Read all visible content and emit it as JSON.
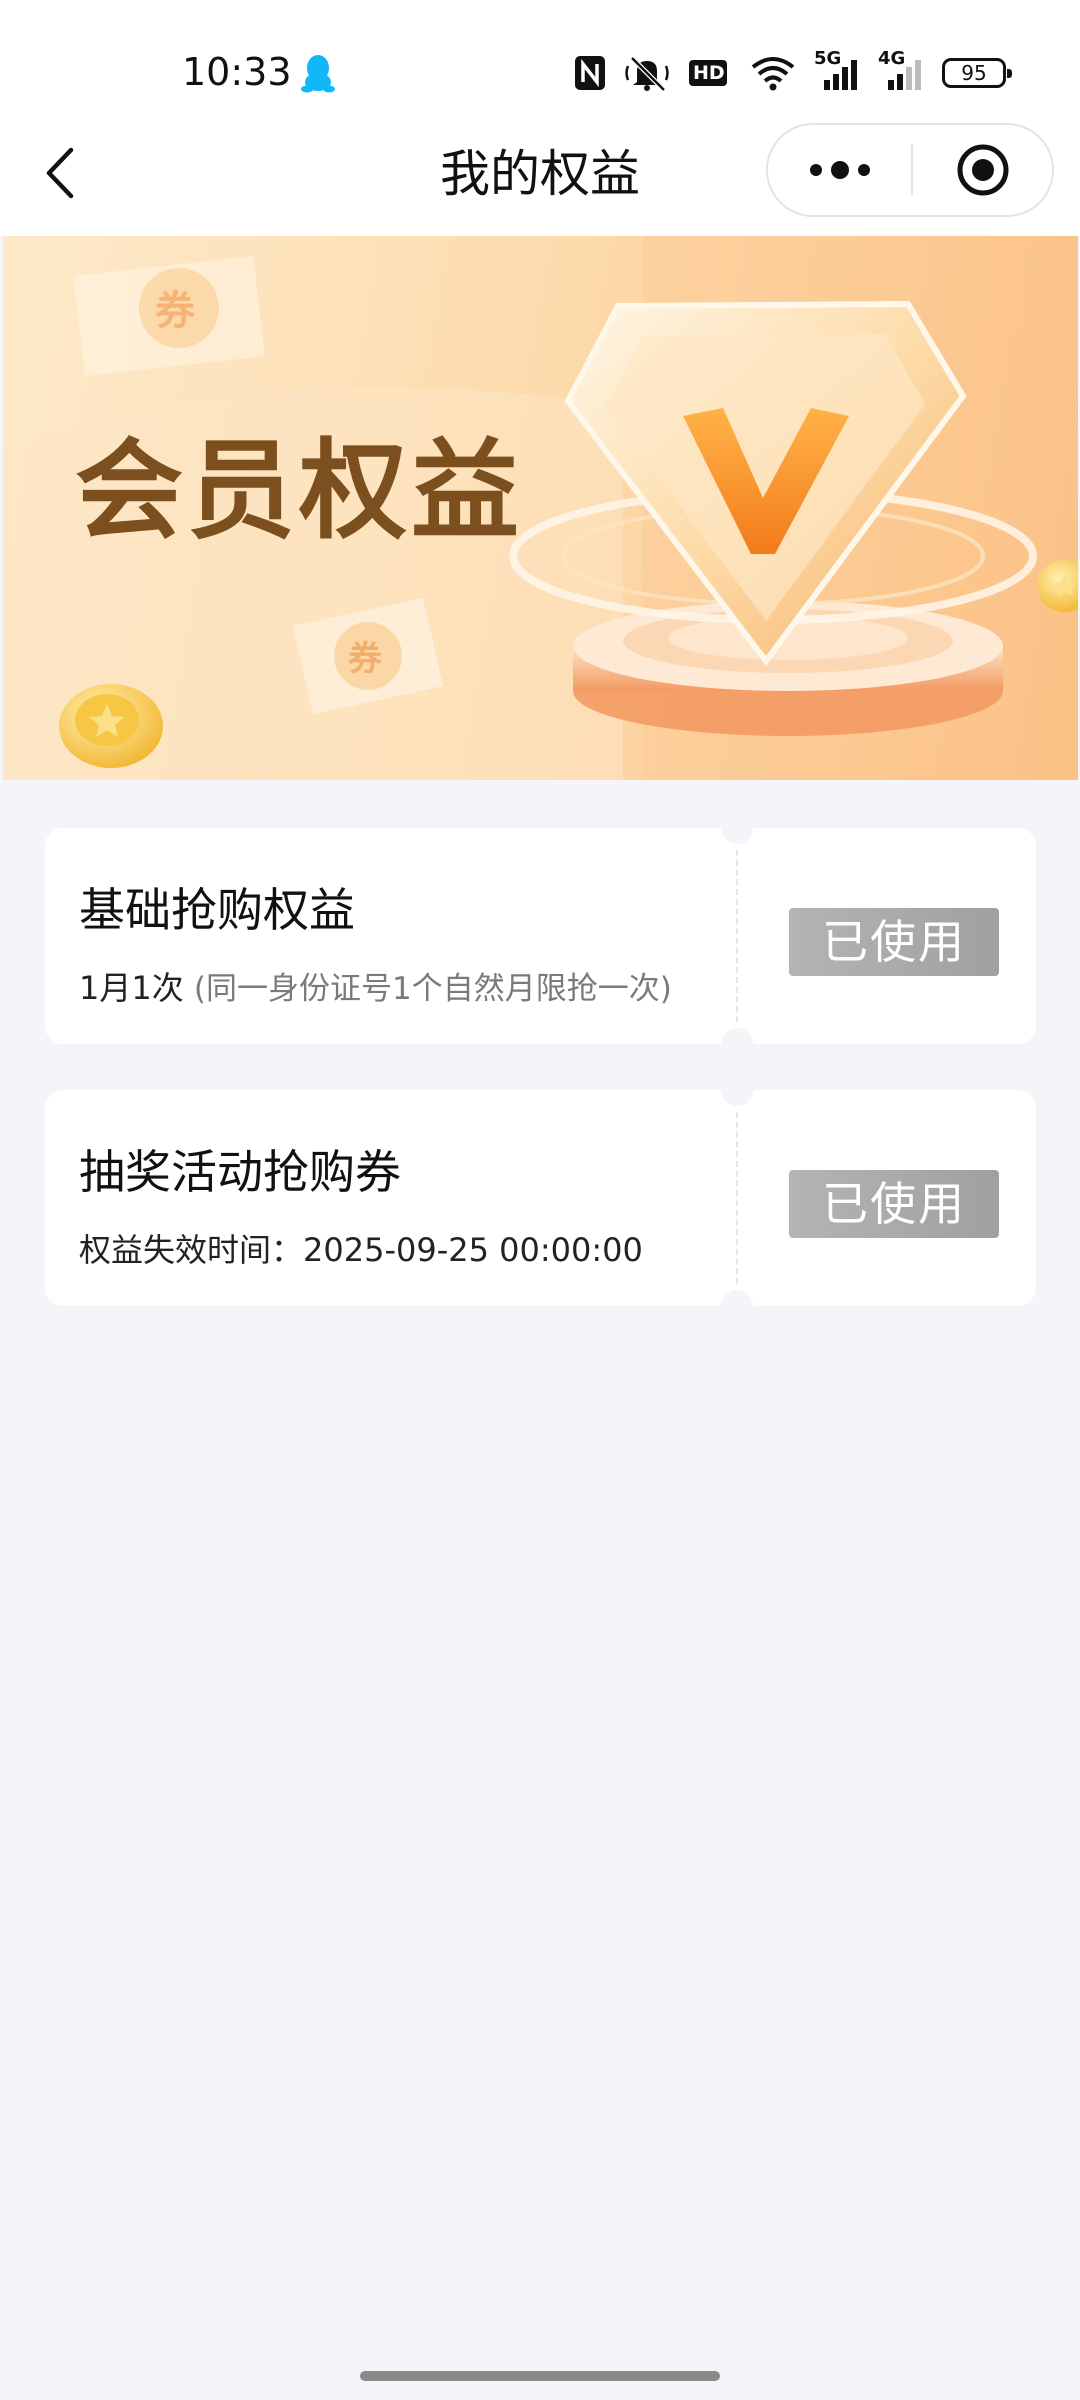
{
  "status_bar": {
    "time": "10:33",
    "network_5g": "5G",
    "network_4g": "4G",
    "hd_label": "HD",
    "battery": "95"
  },
  "nav": {
    "title": "我的权益"
  },
  "banner": {
    "title": "会员权益",
    "colors": {
      "title": "#7c4f1e",
      "gradient_start": "#fde9c9",
      "gradient_end": "#fbbf82"
    }
  },
  "benefits": [
    {
      "title": "基础抢购权益",
      "detail": "1月1次",
      "note": "(同一身份证号1个自然月限抢一次)",
      "status": "已使用"
    },
    {
      "title": "抽奖活动抢购券",
      "detail": "权益失效时间：2025-09-25 00:00:00",
      "note": "",
      "status": "已使用"
    }
  ],
  "colors": {
    "page_background": "#f4f4f9",
    "card_background": "#ffffff",
    "used_button": "#a8a8a8"
  }
}
